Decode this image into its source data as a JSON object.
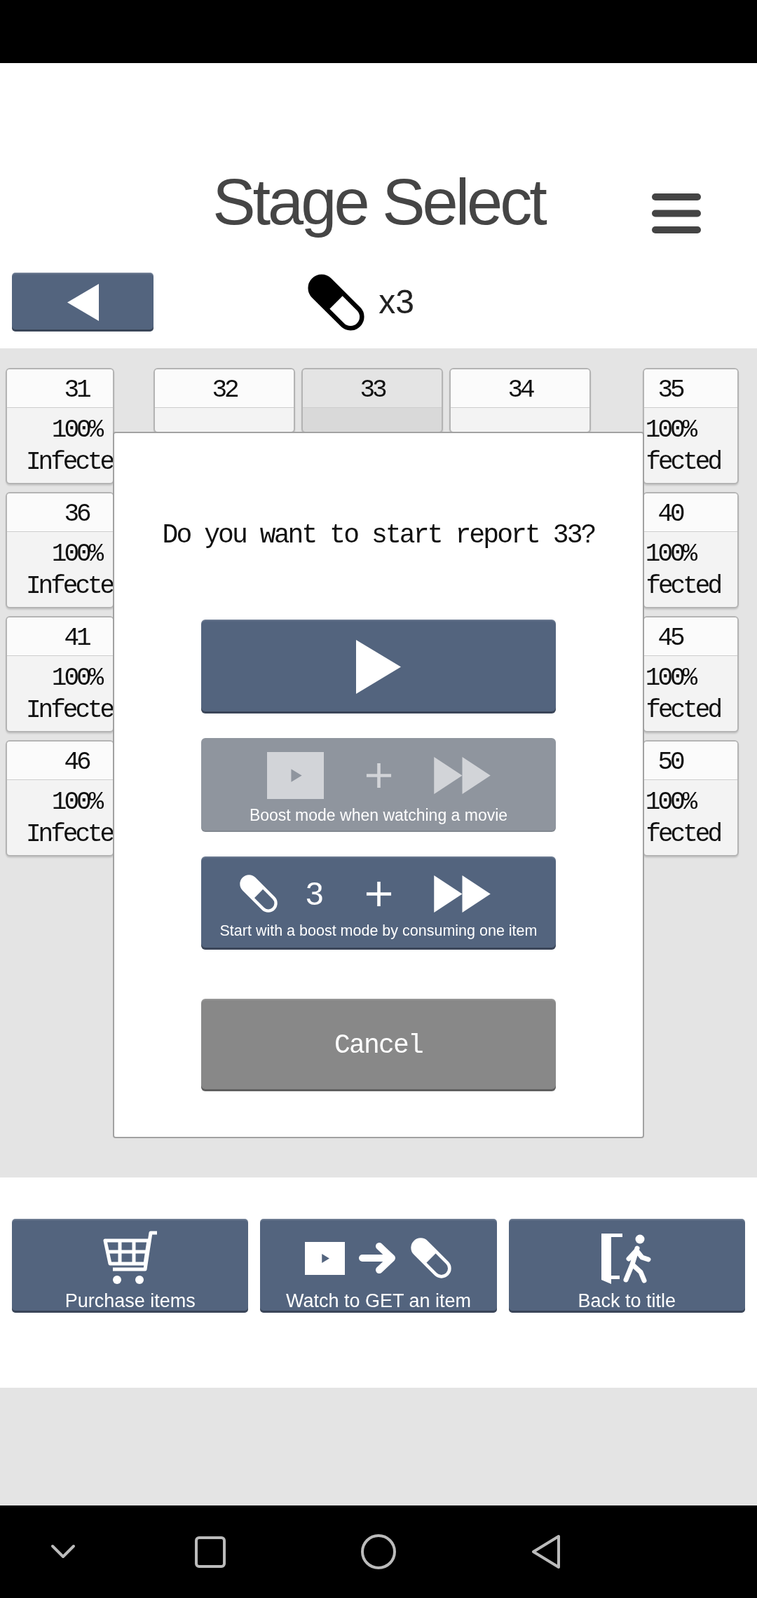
{
  "header": {
    "title": "Stage Select",
    "item_count": "x3"
  },
  "stage_rows": [
    [
      {
        "number": "31",
        "percent": "100%",
        "status": "Infecte",
        "selected": false
      },
      {
        "number": "32",
        "selected": false
      },
      {
        "number": "33",
        "selected": true
      },
      {
        "number": "34",
        "selected": false
      },
      {
        "number": "35",
        "percent": "100%",
        "status": "fected",
        "selected": false
      }
    ],
    [
      {
        "number": "36",
        "percent": "100%",
        "status": "Infecte",
        "selected": false
      },
      {
        "number": "40",
        "percent": "100%",
        "status": "fected",
        "selected": false
      }
    ],
    [
      {
        "number": "41",
        "percent": "100%",
        "status": "Infecte",
        "selected": false
      },
      {
        "number": "45",
        "percent": "100%",
        "status": "fected",
        "selected": false
      }
    ],
    [
      {
        "number": "46",
        "percent": "100%",
        "status": "Infecte",
        "selected": false
      },
      {
        "number": "50",
        "percent": "100%",
        "status": "fected",
        "selected": false
      }
    ]
  ],
  "dialog": {
    "message": "Do you want to start report 33?",
    "buttons": [
      {
        "kind": "play",
        "disabled": false
      },
      {
        "kind": "movie_boost",
        "label": "Boost mode when watching a movie",
        "disabled": true
      },
      {
        "kind": "item_boost",
        "count": "3",
        "label": "Start with a boost mode by consuming one item",
        "disabled": false
      },
      {
        "kind": "cancel",
        "label": "Cancel",
        "disabled": false
      }
    ]
  },
  "bottom_buttons": [
    {
      "kind": "shop",
      "label": "Purchase items"
    },
    {
      "kind": "watch",
      "label": "Watch to GET an item"
    },
    {
      "kind": "exit",
      "label": "Back to title"
    }
  ]
}
